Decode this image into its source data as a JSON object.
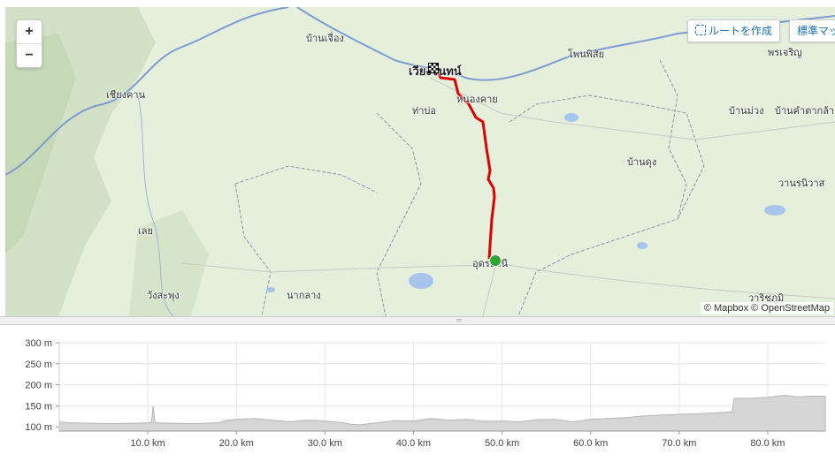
{
  "map": {
    "zoom_in": "+",
    "zoom_out": "−",
    "create_route_label": "ルートを作成",
    "map_style_label": "標準マッ",
    "attribution": "© Mapbox © OpenStreetMap",
    "places": [
      {
        "name": "บ้านเจื่อง",
        "kind": "town"
      },
      {
        "name": "โพนพิสัย",
        "kind": "town"
      },
      {
        "name": "พรเจริญ",
        "kind": "town"
      },
      {
        "name": "เชียงคาน",
        "kind": "town"
      },
      {
        "name": "หนองคาย",
        "kind": "town"
      },
      {
        "name": "ท่าบ่อ",
        "kind": "town"
      },
      {
        "name": "บ้านม่วง",
        "kind": "town"
      },
      {
        "name": "บ้านคำตากล้า",
        "kind": "town"
      },
      {
        "name": "บ้านดุง",
        "kind": "town"
      },
      {
        "name": "วานรนิวาส",
        "kind": "town"
      },
      {
        "name": "เลย",
        "kind": "town"
      },
      {
        "name": "อุดรธานี",
        "kind": "city"
      },
      {
        "name": "วังสะพุง",
        "kind": "town"
      },
      {
        "name": "นากลาง",
        "kind": "town"
      },
      {
        "name": "วาริชภูมิ",
        "kind": "town"
      },
      {
        "name": "เวียงจันทน์",
        "kind": "city"
      }
    ],
    "route_color": "#e00000",
    "start_color": "#2ea52e"
  },
  "chart_data": {
    "type": "area",
    "xlabel": "",
    "ylabel": "",
    "xlim": [
      0,
      86.5
    ],
    "ylim": [
      90,
      300
    ],
    "x_ticks": [
      "10.0 km",
      "20.0 km",
      "30.0 km",
      "40.0 km",
      "50.0 km",
      "60.0 km",
      "70.0 km",
      "80.0 km"
    ],
    "x_tick_values": [
      10,
      20,
      30,
      40,
      50,
      60,
      70,
      80
    ],
    "y_ticks": [
      "100 m",
      "150 m",
      "200 m",
      "250 m",
      "300 m"
    ],
    "y_tick_values": [
      100,
      150,
      200,
      250,
      300
    ],
    "grid": true,
    "series": [
      {
        "x": [
          0,
          1,
          3,
          5,
          7,
          9,
          10.4,
          10.6,
          10.8,
          12,
          14,
          16,
          18,
          19,
          20,
          22,
          24,
          26,
          28,
          30,
          32,
          33,
          34,
          36,
          38,
          40,
          42,
          44,
          46,
          48,
          50,
          52,
          54,
          56,
          58,
          60,
          62,
          64,
          66,
          68,
          70,
          72,
          74,
          76,
          76.2,
          78,
          80,
          81,
          82,
          83,
          84,
          85,
          86.5
        ],
        "values": [
          112,
          110,
          109,
          108,
          108,
          109,
          110,
          150,
          110,
          109,
          108,
          108,
          110,
          116,
          118,
          120,
          116,
          112,
          116,
          114,
          110,
          106,
          105,
          110,
          115,
          114,
          120,
          116,
          118,
          113,
          114,
          112,
          117,
          118,
          112,
          118,
          120,
          122,
          126,
          128,
          130,
          131,
          133,
          136,
          168,
          168,
          170,
          173,
          175,
          172,
          172,
          173,
          173
        ],
        "color": "#b5b5b5"
      }
    ]
  }
}
